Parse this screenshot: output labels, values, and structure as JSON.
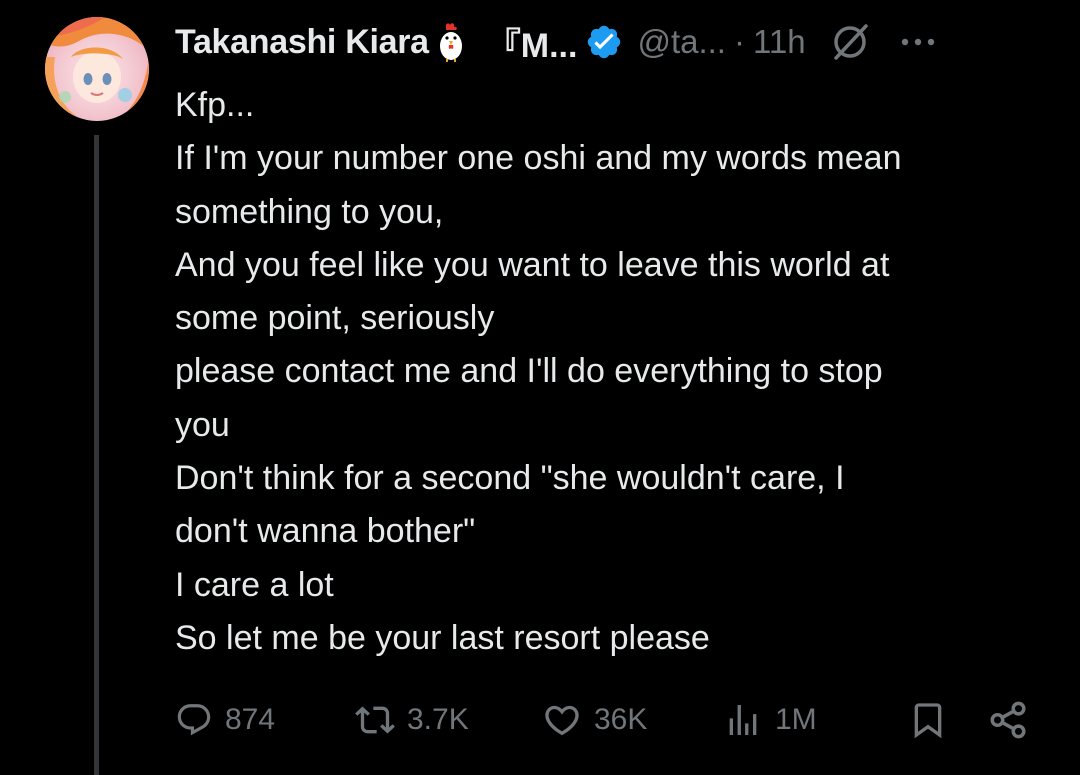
{
  "post": {
    "author": {
      "display_name": "Takanashi Kiara",
      "name_suffix": "『M...",
      "handle": "@ta...",
      "separator": "·",
      "timestamp": "11h",
      "badge_icon": "chicken-emoji",
      "verified": true
    },
    "text_lines": [
      "Kfp...",
      "If I'm your number one oshi and my words mean",
      "something to you,",
      "And you feel like you want to leave this world at",
      "some point, seriously",
      "please contact me and I'll do everything to stop",
      "you",
      "Don't think for a second \"she wouldn't care, I",
      "don't wanna bother\"",
      "I care a lot",
      "So let me be your last resort please"
    ],
    "stats": {
      "replies": "874",
      "reposts": "3.7K",
      "likes": "36K",
      "views": "1M"
    }
  },
  "icons": {
    "reply": "reply-icon",
    "repost": "repost-icon",
    "like": "heart-icon",
    "views": "views-icon",
    "bookmark": "bookmark-icon",
    "share": "share-icon",
    "grok": "grok-icon",
    "more": "more-icon"
  },
  "colors": {
    "background": "#000000",
    "text": "#e7e9ea",
    "secondary": "#71767b",
    "verified": "#1d9bf0",
    "thread_line": "#333639"
  }
}
